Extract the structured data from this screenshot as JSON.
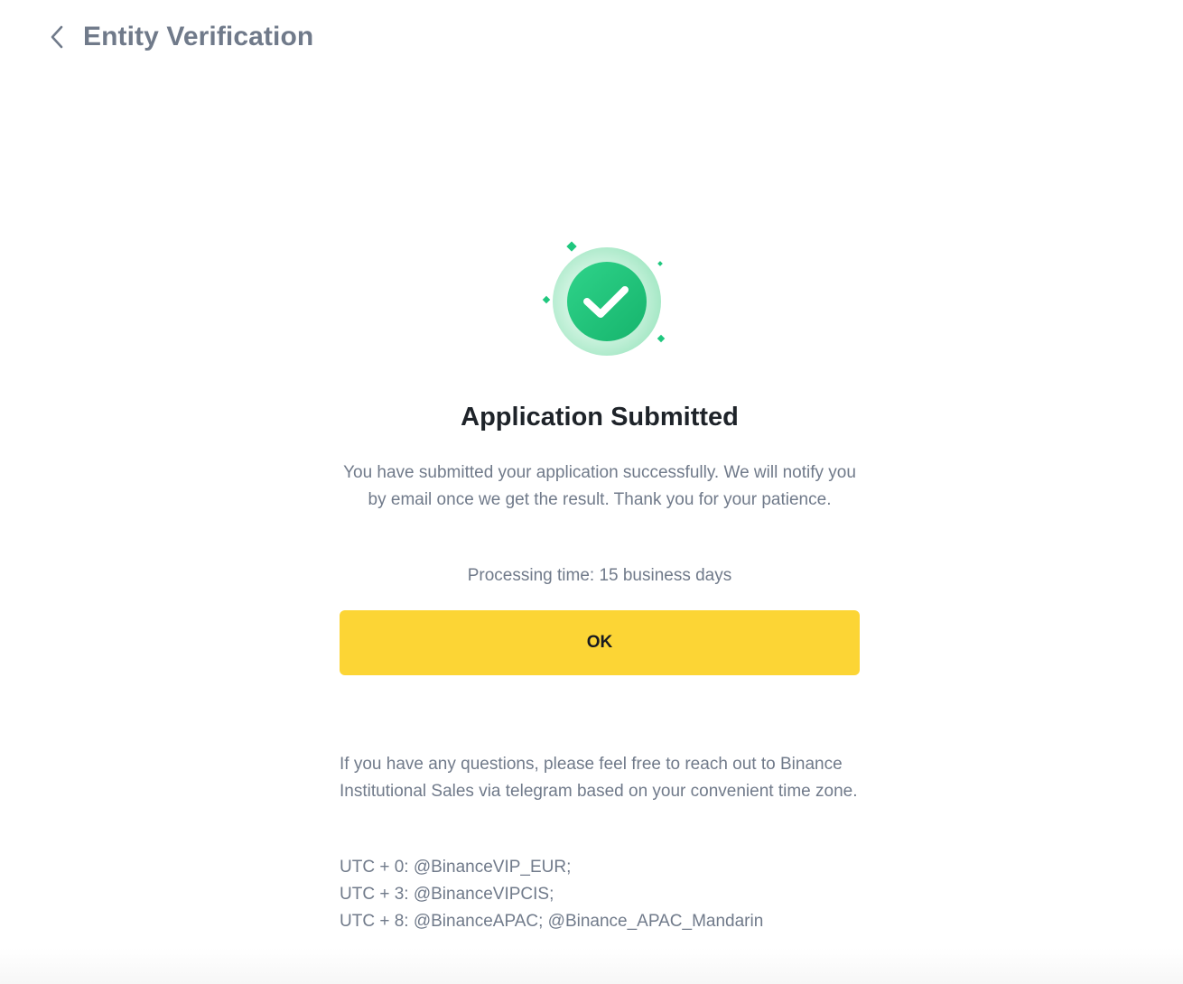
{
  "header": {
    "back_icon": "chevron-left-icon",
    "title": "Entity Verification"
  },
  "result": {
    "icon": "check-circle-icon",
    "accent_color": "#1fc77e",
    "title": "Application Submitted",
    "description": "You have submitted your application successfully. We will notify you by email once we get the result. Thank you for your patience.",
    "processing_time": "Processing time: 15 business days"
  },
  "actions": {
    "ok_label": "OK",
    "ok_color": "#fcd535"
  },
  "contact": {
    "intro": "If you have any questions, please feel free to reach out to Binance Institutional Sales via telegram based on your convenient time zone.",
    "lines": [
      "UTC + 0: @BinanceVIP_EUR;",
      "UTC + 3: @BinanceVIPCIS;",
      "UTC + 8: @BinanceAPAC; @Binance_APAC_Mandarin"
    ]
  }
}
